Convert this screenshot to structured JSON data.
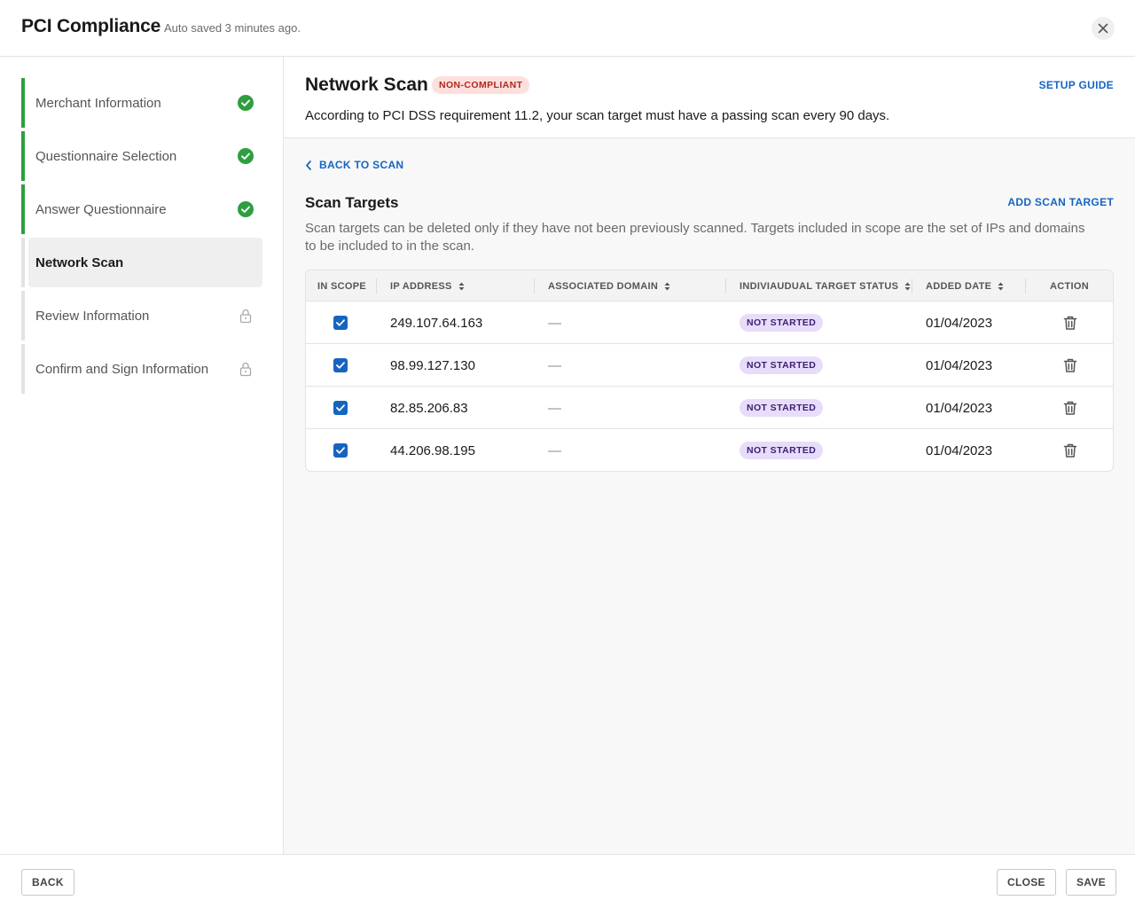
{
  "header": {
    "title": "PCI Compliance",
    "autosave": "Auto saved 3 minutes ago."
  },
  "sidebar": {
    "steps": [
      {
        "label": "Merchant Information",
        "state": "completed",
        "icon": "check-circle-icon"
      },
      {
        "label": "Questionnaire Selection",
        "state": "completed",
        "icon": "check-circle-icon"
      },
      {
        "label": "Answer Questionnaire",
        "state": "completed",
        "icon": "check-circle-icon"
      },
      {
        "label": "Network Scan",
        "state": "active"
      },
      {
        "label": "Review Information",
        "state": "locked",
        "icon": "lock-icon"
      },
      {
        "label": "Confirm and Sign Information",
        "state": "locked",
        "icon": "lock-icon"
      }
    ]
  },
  "main": {
    "title": "Network Scan",
    "badge": "NON-COMPLIANT",
    "setup_guide": "SETUP GUIDE",
    "requirement": "According to PCI DSS requirement 11.2, your scan target must have a passing scan every 90 days.",
    "back_link": "BACK TO SCAN",
    "section_title": "Scan Targets",
    "add_target": "ADD SCAN TARGET",
    "section_desc": "Scan targets can be deleted only if they have not been previously scanned. Targets included in scope are the set of IPs and domains to be included to in the scan.",
    "table": {
      "columns": [
        "IN SCOPE",
        "IP ADDRESS",
        "ASSOCIATED DOMAIN",
        "INDIVIAUDUAL TARGET STATUS",
        "ADDED DATE",
        "ACTION"
      ],
      "rows": [
        {
          "in_scope": true,
          "ip": "249.107.64.163",
          "domain": "—",
          "status": "NOT STARTED",
          "date": "01/04/2023"
        },
        {
          "in_scope": true,
          "ip": "98.99.127.130",
          "domain": "—",
          "status": "NOT STARTED",
          "date": "01/04/2023"
        },
        {
          "in_scope": true,
          "ip": "82.85.206.83",
          "domain": "—",
          "status": "NOT STARTED",
          "date": "01/04/2023"
        },
        {
          "in_scope": true,
          "ip": "44.206.98.195",
          "domain": "—",
          "status": "NOT STARTED",
          "date": "01/04/2023"
        }
      ]
    }
  },
  "footer": {
    "back": "BACK",
    "close": "CLOSE",
    "save": "SAVE"
  },
  "colors": {
    "accent": "#1565c0",
    "success": "#2e9e3e",
    "noncompliant_bg": "#fde0dd",
    "noncompliant_text": "#b3261e",
    "status_bg": "#e8dcfb",
    "status_text": "#3b1f6e"
  }
}
